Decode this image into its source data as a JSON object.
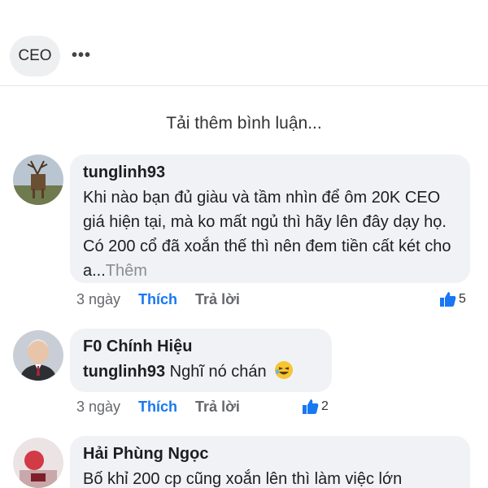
{
  "header": {
    "tag_label": "CEO",
    "more_label": "•••"
  },
  "load_more_label": "Tải thêm bình luận...",
  "comments": [
    {
      "author": "tunglinh93",
      "text": "Khi nào bạn đủ giàu và tầm nhìn để ôm 20K CEO giá hiện tại, mà ko mất ngủ thì hãy lên đây dạy họ. Có 200 cổ đã xoắn thế thì nên đem tiền cất két cho a...",
      "see_more": "Thêm",
      "time": "3 ngày",
      "like_label": "Thích",
      "reply_label": "Trả lời",
      "like_count": "5"
    },
    {
      "author": "F0 Chính Hiệu",
      "mention": "tunglinh93",
      "text": "Nghĩ nó chán",
      "emoji": "laughing-emoji",
      "time": "3 ngày",
      "like_label": "Thích",
      "reply_label": "Trả lời",
      "like_count": "2"
    },
    {
      "author": "Hải Phùng Ngọc",
      "text": "Bố khỉ 200 cp cũng xoắn lên thì làm việc lớn"
    }
  ],
  "colors": {
    "accent": "#1877f2",
    "bubble": "#f0f2f5",
    "muted": "#65676b"
  }
}
